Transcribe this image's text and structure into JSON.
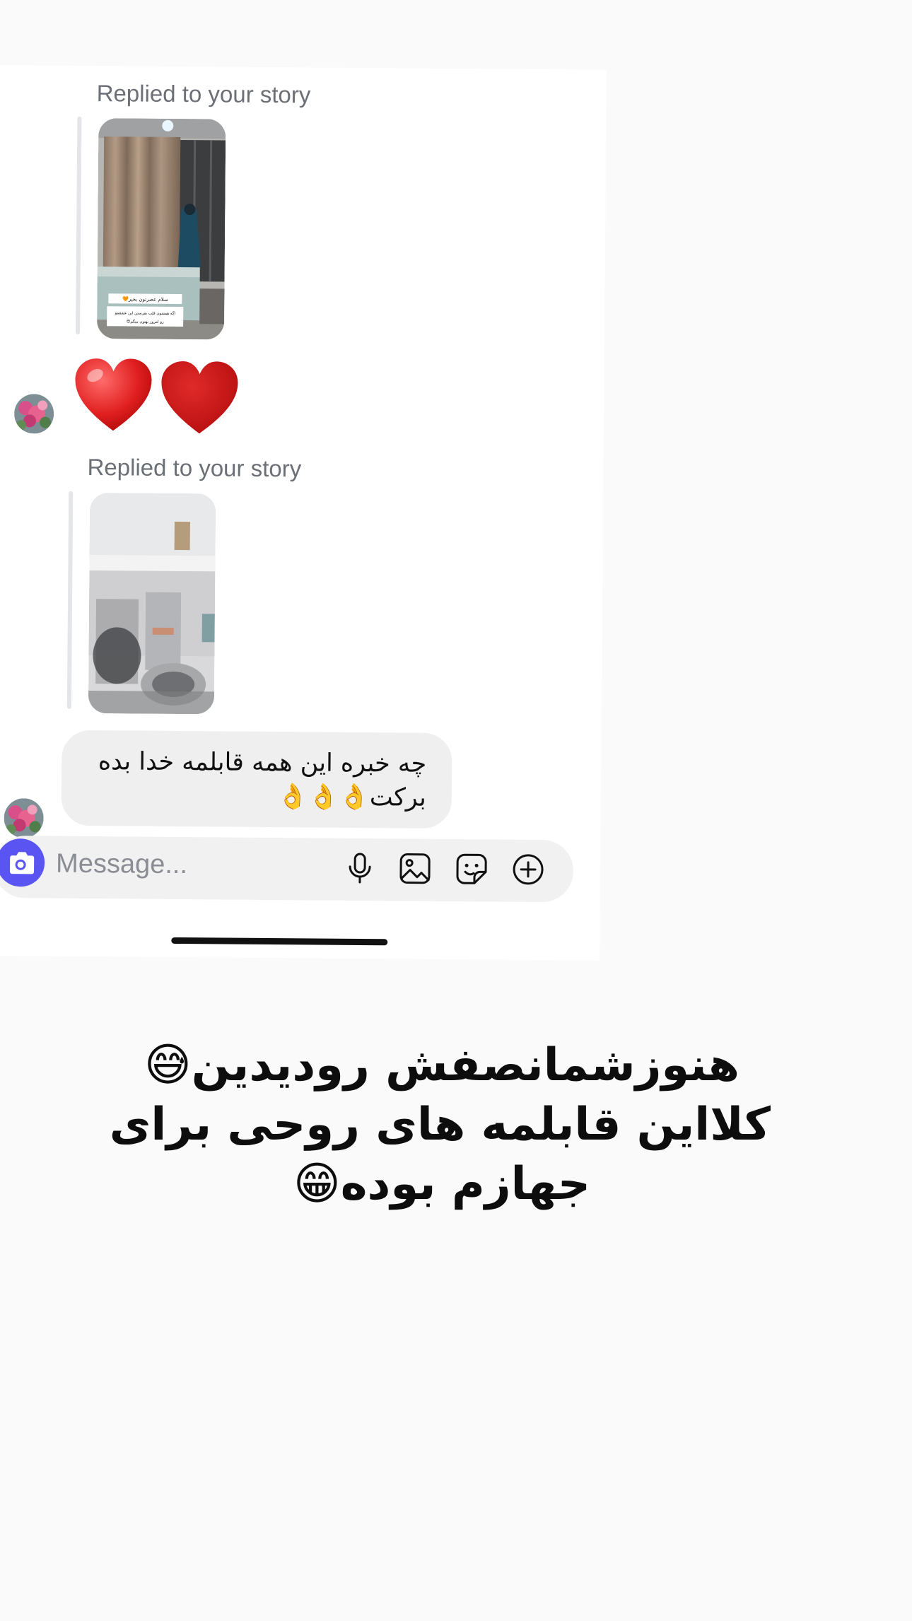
{
  "thread": {
    "replies": [
      {
        "label": "Replied to your story",
        "story_caption_line1": "سلام عصرتون بخیر🧡",
        "story_caption_line2": "اگه همشون قلب بفرستن این عشقمو",
        "story_caption_line3": "رو امروز بهتون میگم😍"
      },
      {
        "label": "Replied to your story"
      }
    ],
    "reaction_hearts": [
      "❤️",
      "❤️"
    ],
    "message_text_line1": "چه خبره این همه قابلمه خدا بده",
    "message_text_line2": "برکت👌👌👌"
  },
  "composer": {
    "placeholder": "Message...",
    "icons": [
      "camera-icon",
      "microphone-icon",
      "image-gallery-icon",
      "sticker-icon",
      "plus-circle-icon"
    ],
    "camera_color": "#5a55f2"
  },
  "caption": {
    "line1": "هنوزشمانصفش رودیدین😅",
    "line2": "کلااین قابلمه های روحی برای",
    "line3": "جهازم بوده😁"
  }
}
